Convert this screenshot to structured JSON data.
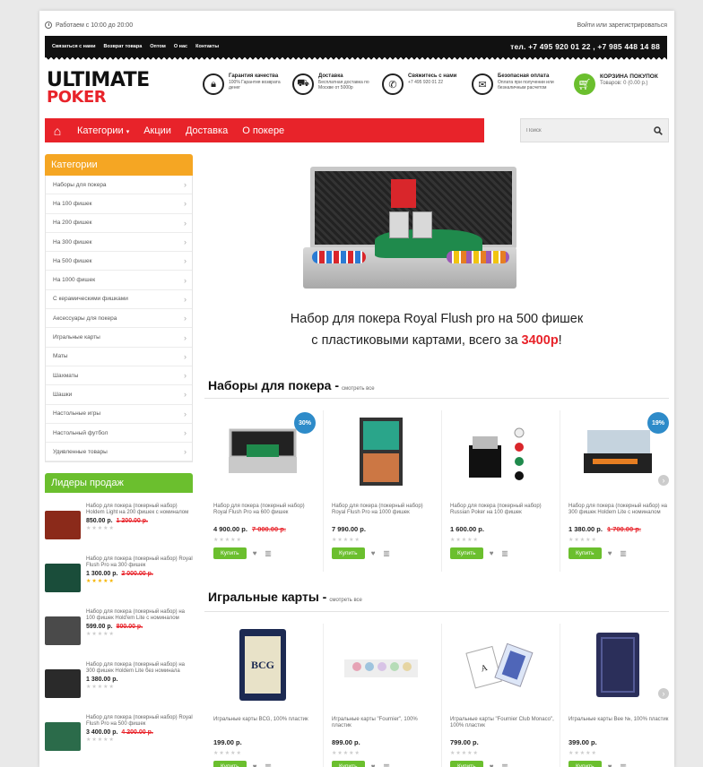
{
  "topline": {
    "hours": "Работаем с 10:00 до 20:00",
    "auth": "Войти или зарегистрироваться"
  },
  "topnav": [
    "Связаться с нами",
    "Возврат товара",
    "Оптом",
    "О нас",
    "Контакты"
  ],
  "phones": "тел. +7 495 920 01 22 , +7 985 448 14 88",
  "logo": {
    "line1": "ULTIMATE",
    "line2": "POKER"
  },
  "features": [
    {
      "icon": "lock-icon",
      "title": "Гарантия качества",
      "text": "100% Гарантия возврата денег"
    },
    {
      "icon": "truck-icon",
      "title": "Доставка",
      "text": "Бесплатная доставка по Москве от 5000р"
    },
    {
      "icon": "phone-icon",
      "title": "Свяжитесь с нами",
      "text": "+7 495 920 01 22"
    },
    {
      "icon": "gift-icon",
      "title": "Безопасная оплата",
      "text": "Оплата при получении или безналичным расчетом"
    }
  ],
  "cart": {
    "title": "КОРЗИНА ПОКУПОК",
    "info": "Товаров: 0 (0.00 р.)"
  },
  "menu": {
    "items": [
      "Категории",
      "Акции",
      "Доставка",
      "О покере"
    ]
  },
  "search": {
    "placeholder": "Поиск"
  },
  "categories": {
    "title": "Категории",
    "items": [
      "Наборы для покера",
      "На 100 фишек",
      "На 200 фишек",
      "На 300 фишек",
      "На 500 фишек",
      "На 1000 фишек",
      "С керамическими фишками",
      "Аксессуары для покера",
      "Игральные карты",
      "Маты",
      "Шахматы",
      "Шашки",
      "Настольные игры",
      "Настольный футбол",
      "Удивленные товары"
    ]
  },
  "leaders": {
    "title": "Лидеры продаж",
    "items": [
      {
        "name": "Набор для покера (покерный набор) Holdem Light на 200 фишек с номиналом",
        "price": "850.00 р.",
        "old": "1 200.00 р.",
        "stars": 0,
        "color": "#8b2a1a"
      },
      {
        "name": "Набор для покера (покерный набор) Royal Flush Pro на 300 фишек",
        "price": "1 300.00 р.",
        "old": "2 000.00 р.",
        "stars": 5,
        "color": "#1a4d3a"
      },
      {
        "name": "Набор для покера (покерный набор) на 100 фишек Hold'em Lite с номиналом",
        "price": "599.00 р.",
        "old": "800.00 р.",
        "stars": 0,
        "color": "#4a4a4a"
      },
      {
        "name": "Набор для покера (покерный набор) на 300 фишек Holdem Lite без номинала",
        "price": "1 380.00 р.",
        "old": "",
        "stars": 0,
        "color": "#2a2a2a"
      },
      {
        "name": "Набор для покера (покерный набор) Royal Flush Pro на 500 фишек",
        "price": "3 400.00 р.",
        "old": "4 200.00 р.",
        "stars": 0,
        "color": "#2b6b4a"
      }
    ]
  },
  "banner": {
    "line1": "Набор для покера Royal Flush pro на 500 фишек",
    "line2": "с пластиковыми картами, всего за",
    "price": "3400",
    "currency": "р",
    "end": "!"
  },
  "section1": {
    "title": "Наборы для покера -",
    "all": "смотреть все",
    "products": [
      {
        "name": "Набор для покера (покерный набор) Royal Flush Pro на 600 фишек",
        "price": "4 900.00 р.",
        "old": "7 000.00 р.",
        "badge": "30%"
      },
      {
        "name": "Набор для покера (покерный набор) Royal Flush Pro на 1000 фишек",
        "price": "7 990.00 р.",
        "old": "",
        "badge": ""
      },
      {
        "name": "Набор для покера (покерный набор) Russian Poker на 100 фишек",
        "price": "1 600.00 р.",
        "old": "",
        "badge": ""
      },
      {
        "name": "Набор для покера (покерный набор) на 300 фишек Holdem Lite с номиналом",
        "price": "1 380.00 р.",
        "old": "1 700.00 р.",
        "badge": "19%"
      }
    ]
  },
  "section2": {
    "title": "Игральные карты -",
    "all": "смотреть все",
    "products": [
      {
        "name": "Игральные карты BCG, 100% пластик",
        "price": "199.00 р.",
        "old": "",
        "badge": ""
      },
      {
        "name": "Игральные карты \"Fournier\", 100% пластик",
        "price": "899.00 р.",
        "old": "",
        "badge": ""
      },
      {
        "name": "Игральные карты \"Fournier Club Monaco\", 100% пластик",
        "price": "799.00 р.",
        "old": "",
        "badge": ""
      },
      {
        "name": "Игральные карты Bee №, 100% пластик",
        "price": "399.00 р.",
        "old": "",
        "badge": ""
      }
    ]
  },
  "buttons": {
    "buy": "Купить"
  }
}
